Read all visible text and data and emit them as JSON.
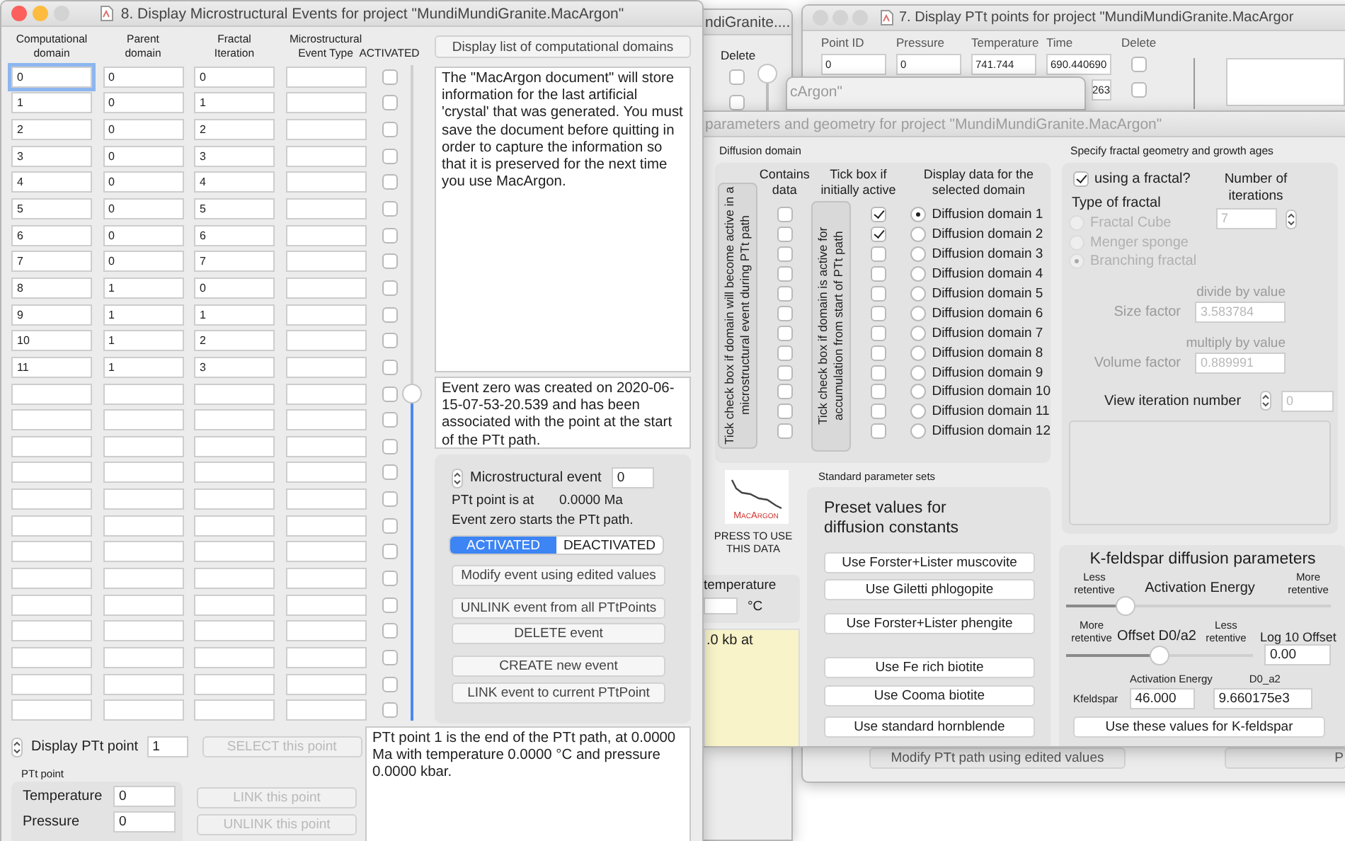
{
  "granite_window": {
    "title": "ndiGranite....",
    "delete_header": "Delete",
    "rows": [
      {
        "delete": false
      },
      {
        "delete": false
      }
    ],
    "slider": {
      "level": 1
    }
  },
  "points_window": {
    "title": "7. Display PTt points for project \"MundiMundiGranite.MacArgor",
    "columns": [
      "Point ID",
      "Pressure",
      "Temperature",
      "Time",
      "Delete"
    ],
    "rows": [
      {
        "point_id": "0",
        "pressure": "0",
        "temperature": "741.744",
        "time": "690.440690",
        "delete": false
      },
      {
        "time": "263",
        "delete": false
      }
    ],
    "buttons": [
      "Modify PTt path using edited values",
      "P"
    ]
  },
  "argon_window": {
    "title": "cArgon\""
  },
  "parameters_window": {
    "title": "parameters and geometry for project \"MundiMundiGranite.MacArgon\"",
    "diffusion": {
      "label": "Diffusion domain",
      "contains_header": "Contains data",
      "active_header": "Tick box if initially active",
      "display_header": "Display data for the selected domain",
      "event_note": "Tick check box if domain will become active in a microstructural event during PTt path",
      "start_note": "Tick check box if domain is active for accumulation from start of PTt path",
      "domains": [
        {
          "name": "Diffusion domain 1",
          "contains_data": false,
          "initially_active": true,
          "selected": true
        },
        {
          "name": "Diffusion domain 2",
          "contains_data": false,
          "initially_active": true,
          "selected": false
        },
        {
          "name": "Diffusion domain 3",
          "contains_data": false,
          "initially_active": false,
          "selected": false
        },
        {
          "name": "Diffusion domain 4",
          "contains_data": false,
          "initially_active": false,
          "selected": false
        },
        {
          "name": "Diffusion domain 5",
          "contains_data": false,
          "initially_active": false,
          "selected": false
        },
        {
          "name": "Diffusion domain 6",
          "contains_data": false,
          "initially_active": false,
          "selected": false
        },
        {
          "name": "Diffusion domain 7",
          "contains_data": false,
          "initially_active": false,
          "selected": false
        },
        {
          "name": "Diffusion domain 8",
          "contains_data": false,
          "initially_active": false,
          "selected": false
        },
        {
          "name": "Diffusion domain 9",
          "contains_data": false,
          "initially_active": false,
          "selected": false
        },
        {
          "name": "Diffusion domain 10",
          "contains_data": false,
          "initially_active": false,
          "selected": false
        },
        {
          "name": "Diffusion domain 11",
          "contains_data": false,
          "initially_active": false,
          "selected": false
        },
        {
          "name": "Diffusion domain 12",
          "contains_data": false,
          "initially_active": false,
          "selected": false
        }
      ]
    },
    "fractal": {
      "label": "Specify fractal geometry and growth ages",
      "using_fractal": {
        "label": "using a fractal?",
        "checked": true
      },
      "type_label": "Type of fractal",
      "types": [
        {
          "label": "Fractal Cube",
          "selected": false
        },
        {
          "label": "Menger sponge",
          "selected": false
        },
        {
          "label": "Branching fractal",
          "selected": true
        }
      ],
      "inputs_disabled": true,
      "iterations_label": "Number of iterations",
      "iterations": "7",
      "size_hint": "divide by value",
      "size_label": "Size factor",
      "size": "3.583784",
      "volume_hint": "multiply by value",
      "volume_label": "Volume factor",
      "volume": "0.889991",
      "view_label": "View iteration number",
      "view": "0"
    },
    "logo": {
      "name": "MacArgon",
      "caption": "PRESS TO USE THIS DATA"
    },
    "temperature": {
      "label": "temperature",
      "unit": "°C"
    },
    "pressure_note": ".0 kb at",
    "standard_sets": {
      "label": "Standard parameter sets",
      "heading": "Preset values for diffusion constants",
      "buttons": [
        "Use Forster+Lister muscovite",
        "Use Giletti phlogopite",
        "Use Forster+Lister phengite",
        "Use Fe rich biotite",
        "Use Cooma biotite",
        "Use standard hornblende"
      ]
    },
    "kfeldspar": {
      "title": "K-feldspar diffusion parameters",
      "energy": {
        "left": "Less retentive",
        "label": "Activation Energy",
        "right": "More retentive",
        "level": 0.2
      },
      "offset": {
        "left": "More retentive",
        "label": "Offset D0/a2",
        "right": "Less retentive",
        "level": 0.5,
        "log_label": "Log 10 Offset",
        "log_value": "0.00"
      },
      "energy_header": "Activation Energy",
      "d0_header": "D0_a2",
      "row_label": "Kfeldspar",
      "energy_value": "46.000",
      "d0_value": "9.660175e3",
      "button": "Use these values for K-feldspar"
    }
  },
  "events_window": {
    "title": "8. Display Microstructural Events for project \"MundiMundiGranite.MacArgon\"",
    "columns": [
      "Computational domain",
      "Parent domain",
      "Fractal Iteration",
      "Microstructural Event Type",
      "ACTIVATED"
    ],
    "rows": [
      {
        "domain": "0",
        "parent": "0",
        "iteration": "0",
        "activated": false,
        "focused": true
      },
      {
        "domain": "1",
        "parent": "0",
        "iteration": "1",
        "activated": false,
        "focused": false
      },
      {
        "domain": "2",
        "parent": "0",
        "iteration": "2",
        "activated": false,
        "focused": false
      },
      {
        "domain": "3",
        "parent": "0",
        "iteration": "3",
        "activated": false,
        "focused": false
      },
      {
        "domain": "4",
        "parent": "0",
        "iteration": "4",
        "activated": false,
        "focused": false
      },
      {
        "domain": "5",
        "parent": "0",
        "iteration": "5",
        "activated": false,
        "focused": false
      },
      {
        "domain": "6",
        "parent": "0",
        "iteration": "6",
        "activated": false,
        "focused": false
      },
      {
        "domain": "7",
        "parent": "0",
        "iteration": "7",
        "activated": false,
        "focused": false
      },
      {
        "domain": "8",
        "parent": "1",
        "iteration": "0",
        "activated": false,
        "focused": false
      },
      {
        "domain": "9",
        "parent": "1",
        "iteration": "1",
        "activated": false,
        "focused": false
      },
      {
        "domain": "10",
        "parent": "1",
        "iteration": "2",
        "activated": false,
        "focused": false
      },
      {
        "domain": "11",
        "parent": "1",
        "iteration": "3",
        "activated": false,
        "focused": false
      },
      {
        "activated": false,
        "focused": false
      },
      {
        "activated": false,
        "focused": false
      },
      {
        "activated": false,
        "focused": false
      },
      {
        "activated": false,
        "focused": false
      },
      {
        "activated": false,
        "focused": false
      },
      {
        "activated": false,
        "focused": false
      },
      {
        "activated": false,
        "focused": false
      },
      {
        "activated": false,
        "focused": false
      },
      {
        "activated": false,
        "focused": false
      },
      {
        "activated": false,
        "focused": false
      },
      {
        "activated": false,
        "focused": false
      },
      {
        "activated": false,
        "focused": false
      },
      {
        "activated": false,
        "focused": false
      }
    ],
    "scroll_slider": {
      "level": 0.5
    },
    "display_list_button": "Display list of computational domains",
    "document_note": "The \"MacArgon document\" will store information for the last artificial 'crystal' that was generated. You must save the document before quitting in order to capture the information so that it is preserved for the next time you use MacArgon.",
    "event_note": "Event zero was created on 2020-06-15-07-53-20.539 and has been associated with the point at the start of the PTt path.",
    "event_panel": {
      "label": "Microstructural event",
      "value": "0",
      "ptt_label": "PTt point is at",
      "ptt_value": "0.0000 Ma",
      "status": "Event zero starts the PTt path.",
      "segments": [
        {
          "label": "ACTIVATED",
          "selected": true
        },
        {
          "label": "DEACTIVATED",
          "selected": false
        }
      ],
      "buttons": [
        "Modify event using edited values",
        "UNLINK event from all PTtPoints",
        "DELETE event",
        "CREATE new event",
        "LINK event to current PTtPoint"
      ]
    },
    "ptt_display": {
      "label": "Display PTt point",
      "value": "1",
      "select_button": {
        "label": "SELECT this point",
        "disabled": true
      }
    },
    "ptt_point": {
      "title": "PTt point",
      "fields": [
        {
          "label": "Temperature",
          "value": "0"
        },
        {
          "label": "Pressure",
          "value": "0"
        }
      ]
    },
    "link_buttons": [
      {
        "label": "LINK this point",
        "disabled": true
      },
      {
        "label": "UNLINK this point",
        "disabled": true
      }
    ],
    "ptt_note": "PTt point 1 is the end of the PTt path, at 0.0000 Ma with temperature 0.0000 °C and pressure 0.0000 kbar."
  }
}
